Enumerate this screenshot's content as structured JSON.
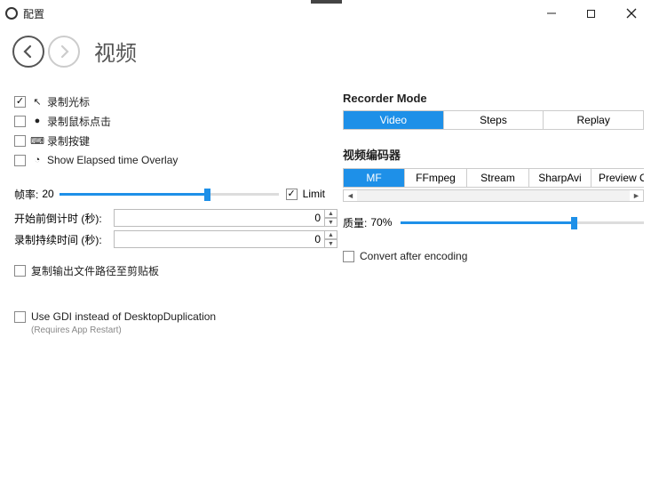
{
  "window": {
    "title": "配置"
  },
  "page": {
    "title": "视频"
  },
  "left_checks": [
    {
      "icon": "↖",
      "label": "录制光标",
      "checked": true
    },
    {
      "icon": "●",
      "label": "录制鼠标点击",
      "checked": false
    },
    {
      "icon": "⌨",
      "label": "录制按键",
      "checked": false
    },
    {
      "icon": "◔",
      "label": "Show Elapsed time Overlay",
      "checked": false
    }
  ],
  "framerate": {
    "label": "帧率:",
    "value": "20",
    "min": 0,
    "max": 30,
    "limit_label": "Limit",
    "limit_checked": true
  },
  "countdown": {
    "label": "开始前倒计时 (秒):",
    "value": "0"
  },
  "duration": {
    "label": "录制持续时间 (秒):",
    "value": "0"
  },
  "copy_output": {
    "label": "复制输出文件路径至剪贴板",
    "checked": false
  },
  "use_gdi": {
    "label": "Use GDI instead of DesktopDuplication",
    "note": "(Requires App Restart)",
    "checked": false
  },
  "recorder_mode": {
    "heading": "Recorder Mode",
    "tabs": [
      "Video",
      "Steps",
      "Replay"
    ],
    "active": 0
  },
  "encoder": {
    "heading": "视频编码器",
    "tabs": [
      "MF",
      "FFmpeg",
      "Stream",
      "SharpAvi",
      "Preview Or"
    ],
    "active": 0
  },
  "quality": {
    "label": "质量:",
    "value": "70%",
    "percent": 70
  },
  "convert_after": {
    "label": "Convert after encoding",
    "checked": false
  }
}
